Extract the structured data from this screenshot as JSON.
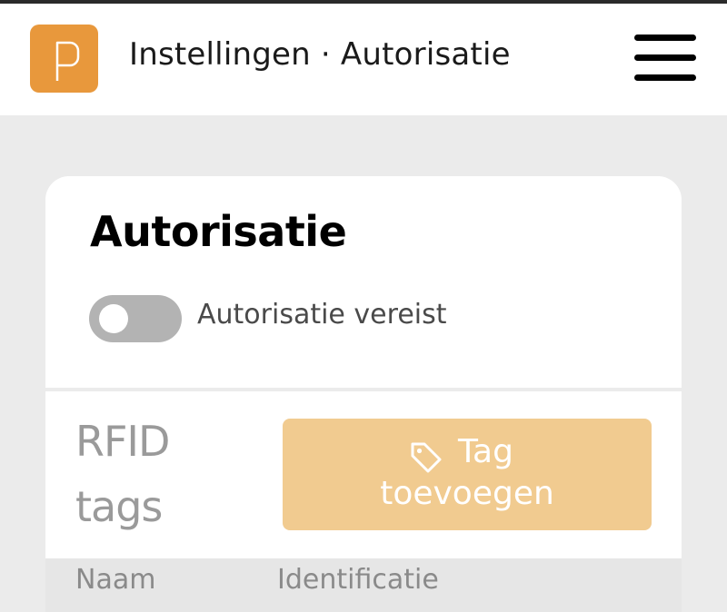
{
  "header": {
    "title": "Instellingen · Autorisatie",
    "logo_icon": "p-logo-icon",
    "menu_icon": "hamburger-menu-icon"
  },
  "card": {
    "title": "Autorisatie",
    "toggle": {
      "label": "Autorisatie vereist",
      "checked": false
    }
  },
  "rfid": {
    "title_line1": "RFID",
    "title_line2": "tags",
    "add_button": {
      "icon": "tag-icon",
      "label_line1": "Tag",
      "label_line2": "toevoegen"
    },
    "table": {
      "columns": [
        "Naam",
        "Identificatie"
      ]
    }
  },
  "colors": {
    "brand": "#e8983c",
    "button": "#f1cb90",
    "background": "#ebebeb"
  }
}
